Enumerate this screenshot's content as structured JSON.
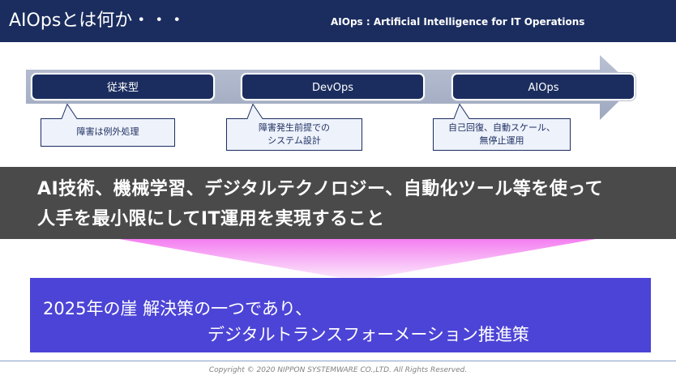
{
  "header": {
    "title": "AIOpsとは何か・・・",
    "subtitle": "AIOps : Artificial Intelligence for IT Operations"
  },
  "timeline": {
    "stages": [
      {
        "label": "従来型",
        "callout": [
          "障害は例外処理"
        ]
      },
      {
        "label": "DevOps",
        "callout": [
          "障害発生前提での",
          "システム設計"
        ]
      },
      {
        "label": "AIOps",
        "callout": [
          "自己回復、自動スケール、",
          "無停止運用"
        ]
      }
    ]
  },
  "band": {
    "line1": "AI技術、機械学習、デジタルテクノロジー、自動化ツール等を使って",
    "line2": "人手を最小限にしてIT運用を実現すること"
  },
  "conclusion": {
    "line1": "2025年の崖 解決策の一つであり、",
    "line2": "デジタルトランスフォーメーション推進策"
  },
  "footer": {
    "copyright": "Copyright © 2020   NIPPON SYSTEMWARE CO.,LTD. All Rights Reserved."
  },
  "colors": {
    "navy": "#1b2d5f",
    "band": "#4a4a4a",
    "purple": "#4c44d6",
    "gradient_pink": "#ee80ee"
  }
}
